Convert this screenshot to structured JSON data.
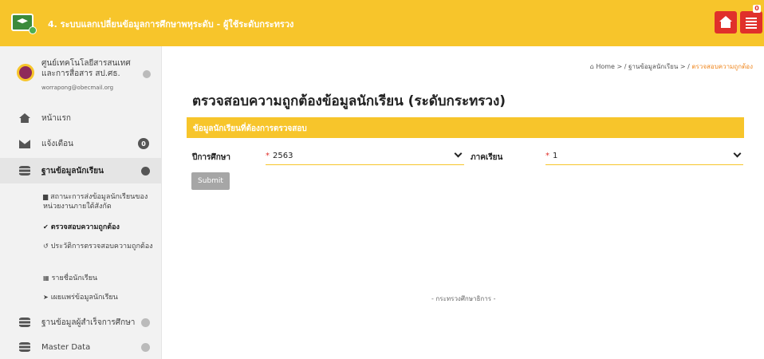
{
  "header": {
    "title": "4. ระบบแลกเปลี่ยนข้อมูลการศึกษาพหุระดับ - ผู้ใช้ระดับกระทรวง",
    "notification_count": "0"
  },
  "sidebar": {
    "org_name": "ศูนย์เทคโนโลยีสารสนเทศและการสื่อสาร สป.ศธ.",
    "org_email": "worrapong@obecmail.org",
    "items": [
      {
        "label": "หน้าแรก"
      },
      {
        "label": "แจ้งเตือน",
        "badge": "0"
      },
      {
        "label": "ฐานข้อมูลนักเรียน"
      },
      {
        "label": "ฐานข้อมูลผู้สำเร็จการศึกษา"
      },
      {
        "label": "Master Data"
      }
    ],
    "sub_items": [
      {
        "label": "สถานะการส่งข้อมูลนักเรียนของหน่วยงานภายใต้สังกัด"
      },
      {
        "label": "ตรวจสอบความถูกต้อง"
      },
      {
        "label": "ประวัติการตรวจสอบความถูกต้อง"
      },
      {
        "label": "รายชื่อนักเรียน"
      },
      {
        "label": "เผยแพร่ข้อมูลนักเรียน"
      }
    ]
  },
  "breadcrumb": {
    "home": "Home",
    "level2": "ฐานข้อมูลนักเรียน",
    "current": "ตรวจสอบความถูกต้อง"
  },
  "main": {
    "page_title": "ตรวจสอบความถูกต้องข้อมูลนักเรียน (ระดับกระทรวง)",
    "panel_title": "ข้อมูลนักเรียนที่ต้องการตรวจสอบ",
    "academic_year_label": "ปีการศึกษา",
    "academic_year_value": "2563",
    "semester_label": "ภาคเรียน",
    "semester_value": "1",
    "required_mark": "*",
    "submit_label": "Submit",
    "footer": "- กระทรวงศึกษาธิการ -"
  },
  "colors": {
    "accent": "#f7c52b",
    "danger": "#e0302b",
    "breadcrumb_active": "#f08a24"
  }
}
